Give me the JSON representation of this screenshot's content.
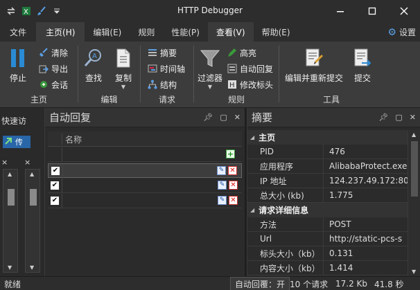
{
  "window": {
    "title": "HTTP Debugger"
  },
  "quick_access": [
    "swap-icon",
    "excel-icon",
    "brush-icon",
    "dropdown-icon"
  ],
  "tabs": [
    {
      "label": "文件"
    },
    {
      "label": "主页(H)"
    },
    {
      "label": "编辑(E)"
    },
    {
      "label": "规则"
    },
    {
      "label": "性能(P)"
    },
    {
      "label": "查看(V)"
    },
    {
      "label": "帮助(E)"
    }
  ],
  "settings_label": "设置",
  "ribbon": {
    "group_home": {
      "label": "主页",
      "stop": "停止",
      "clear": "清除",
      "export": "导出",
      "session": "会话"
    },
    "group_edit": {
      "label": "编辑",
      "find": "查找",
      "copy": "复制"
    },
    "group_request": {
      "label": "请求",
      "summary": "摘要",
      "timeline": "时间轴",
      "structure": "结构"
    },
    "group_rules": {
      "label": "规则",
      "filter": "过滤器",
      "highlight": "高亮",
      "auto_reply": "自动回复",
      "modify_headers": "修改标头"
    },
    "group_tools": {
      "label": "工具",
      "edit_resubmit": "编辑并重新提交",
      "submit": "提交"
    }
  },
  "left_pane": {
    "title": "快速访",
    "blue_item": "传",
    "x1": "×",
    "x2": "×"
  },
  "auto_reply_panel": {
    "title": "自动回复",
    "column_name": "名称",
    "rows": [
      {
        "checked": "✔",
        "name": ""
      },
      {
        "checked": "✔",
        "name": ""
      },
      {
        "checked": "✔",
        "name": ""
      }
    ]
  },
  "summary_panel": {
    "title": "摘要",
    "sections": [
      {
        "label": "主页",
        "props": [
          {
            "k": "PID",
            "v": "476"
          },
          {
            "k": "应用程序",
            "v": "AlibabaProtect.exe"
          },
          {
            "k": "IP 地址",
            "v": "124.237.49.172:80"
          },
          {
            "k": "总大小 (kb)",
            "v": "1.775"
          }
        ]
      },
      {
        "label": "请求详细信息",
        "props": [
          {
            "k": "方法",
            "v": "POST"
          },
          {
            "k": "Url",
            "v": "http://static-pcs-s"
          },
          {
            "k": "标头大小（kb）",
            "v": "0.131"
          },
          {
            "k": "内容大小（kb）",
            "v": "1.414"
          }
        ]
      }
    ]
  },
  "status_bar": {
    "ready": "就绪",
    "auto_reply": "自动回覆：开",
    "requests": "10 个请求",
    "size": "17.2 Kb",
    "time": "41.8 秒"
  },
  "colors": {
    "accent_blue": "#2a8ad4",
    "selected_tab": "#3c3c3c",
    "delete_red": "#d11111",
    "add_green": "#1d8a1d"
  }
}
